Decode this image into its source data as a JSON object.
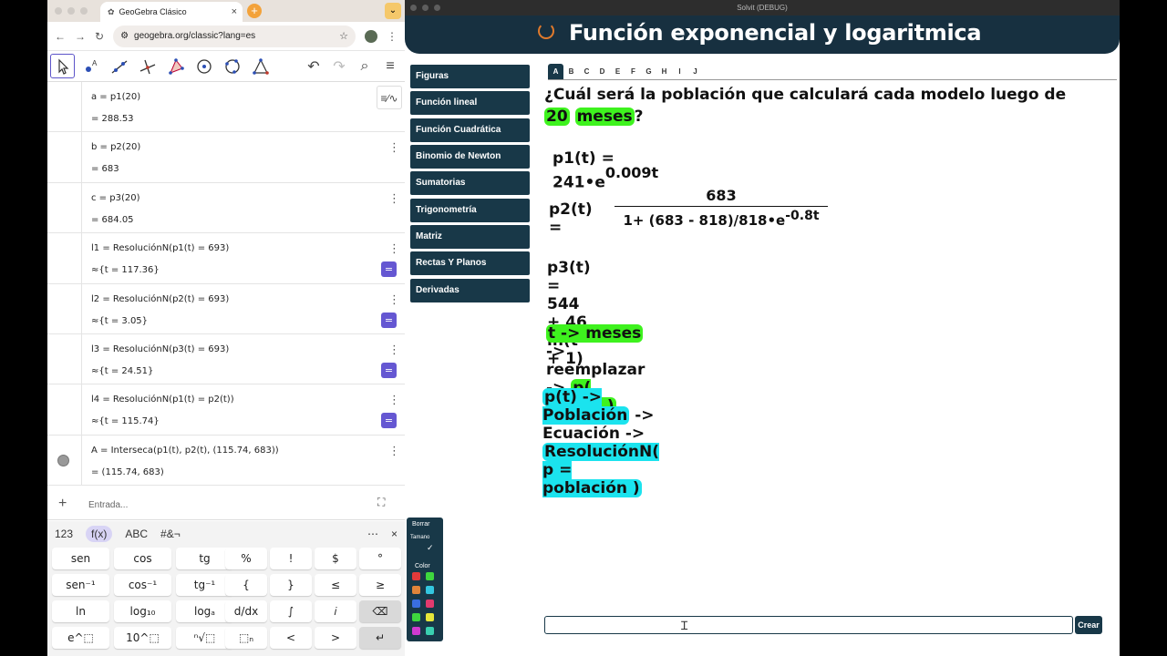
{
  "browser": {
    "tab_title": "GeoGebra Clásico",
    "url": "geogebra.org/classic?lang=es"
  },
  "algebra": {
    "rows": [
      {
        "def": "a  =  p1(20)",
        "val": "=  288.53"
      },
      {
        "def": "b  =  p2(20)",
        "val": "=  683"
      },
      {
        "def": "c  =  p3(20)",
        "val": "=  684.05"
      },
      {
        "def": "l1  =  ResoluciónN(p1(t)  =  693)",
        "val": "≈{t  =  117.36}"
      },
      {
        "def": "l2  =  ResoluciónN(p2(t)  =  693)",
        "val": "≈{t  =  3.05}"
      },
      {
        "def": "l3  =  ResoluciónN(p3(t)  =  693)",
        "val": "≈{t  =  24.51}"
      },
      {
        "def": "l4  =  ResoluciónN(p1(t)  =  p2(t))",
        "val": "≈{t  =  115.74}"
      },
      {
        "def": "A  =  Interseca(p1(t), p2(t), (115.74,  683))",
        "val": "=  (115.74,  683)"
      }
    ],
    "input_placeholder": "Entrada..."
  },
  "keyboard": {
    "tabs": [
      "123",
      "f(x)",
      "ABC",
      "#&¬"
    ],
    "keys": [
      [
        "sen",
        "cos",
        "tg",
        "%",
        "!",
        "$",
        "°"
      ],
      [
        "sen⁻¹",
        "cos⁻¹",
        "tg⁻¹",
        "{",
        "}",
        "≤",
        "≥"
      ],
      [
        "ln",
        "log₁₀",
        "logₐ",
        "d/dx",
        "∫",
        "𝑖",
        "⌫"
      ],
      [
        "e^⬚",
        "10^⬚",
        "ⁿ√⬚",
        "⬚ₙ",
        "<",
        ">",
        "↵"
      ]
    ]
  },
  "app": {
    "window_title": "Solvit (DEBUG)",
    "header_title": "Función exponencial y logaritmica",
    "sidebar": [
      "Figuras",
      "Función lineal",
      "Función Cuadrática",
      "Binomio de Newton",
      "Sumatorias",
      "Trigonometría",
      "Matriz",
      "Rectas Y Planos",
      "Derivadas"
    ],
    "tabs": [
      "A",
      "B",
      "C",
      "D",
      "E",
      "F",
      "G",
      "H",
      "I",
      "J"
    ],
    "question_pre": "¿Cuál será la población que calculará cada modelo luego de ",
    "question_hl1": "20",
    "question_hl2": "meses",
    "question_post": "?",
    "eq1": "p1(t) = 241•e",
    "eq1_exp": "0.009t",
    "eq2_lhs": "p2(t) =",
    "eq2_num": "683",
    "eq2_den": "1+ (683 - 818)/818•e",
    "eq2_den_exp": "-0.8t",
    "eq3": "p3(t) = 544 + 46 ln(t + 1)",
    "line1_a": "t -> meses",
    "line1_b": " -> reemplazar -> ",
    "line1_c": "p( meses )",
    "line2_a": "p(t) -> Población",
    "line2_b": " -> Ecuación -> ",
    "line2_c": "ResoluciónN( p = población )",
    "palette_borrar": "Borrar",
    "palette_tamano": "Tamano",
    "palette_color": "Color",
    "palette_colors": [
      "#e23a3a",
      "#3ed63e",
      "#e0843a",
      "#33c6e0",
      "#3a6ee0",
      "#e23a6e",
      "#3ed63e",
      "#e6e63a",
      "#d03ad0",
      "#3ad0b0"
    ],
    "crear": "Crear"
  }
}
